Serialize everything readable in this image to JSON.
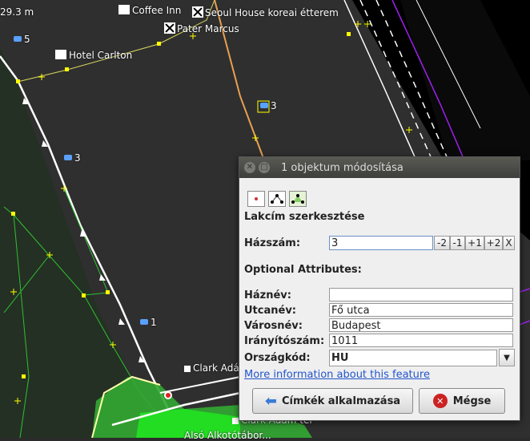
{
  "map": {
    "scale_label": "29.3 m",
    "labels": {
      "coffee": "Coffee Inn",
      "seoul": "Seoul House koreai étterem",
      "pater": "Pater Marcus",
      "hotel": "Hotel Carlton",
      "addr5": "5",
      "addr3a": "3",
      "addr3b": "3",
      "addr1": "1",
      "clark1": "Clark Adá",
      "clark2": "Clark Ádám tér",
      "bottom": "Alsó Alkotótábor..."
    }
  },
  "dialog": {
    "title": "1 objektum módosítása",
    "section_title": "Lakcím szerkesztése",
    "housenumber_label": "Házszám:",
    "housenumber_value": "3",
    "step_buttons": [
      "-2",
      "-1",
      "+1",
      "+2",
      "X"
    ],
    "optional_title": "Optional Attributes:",
    "housename_label": "Háznév:",
    "housename_value": "",
    "street_label": "Utcanév:",
    "street_value": "Fő utca",
    "city_label": "Városnév:",
    "city_value": "Budapest",
    "postcode_label": "Irányítószám:",
    "postcode_value": "1011",
    "country_label": "Országkód:",
    "country_value": "HU",
    "more_info_link": "More information about this feature",
    "apply_button": "Címkék alkalmazása",
    "cancel_button": "Mégse"
  }
}
